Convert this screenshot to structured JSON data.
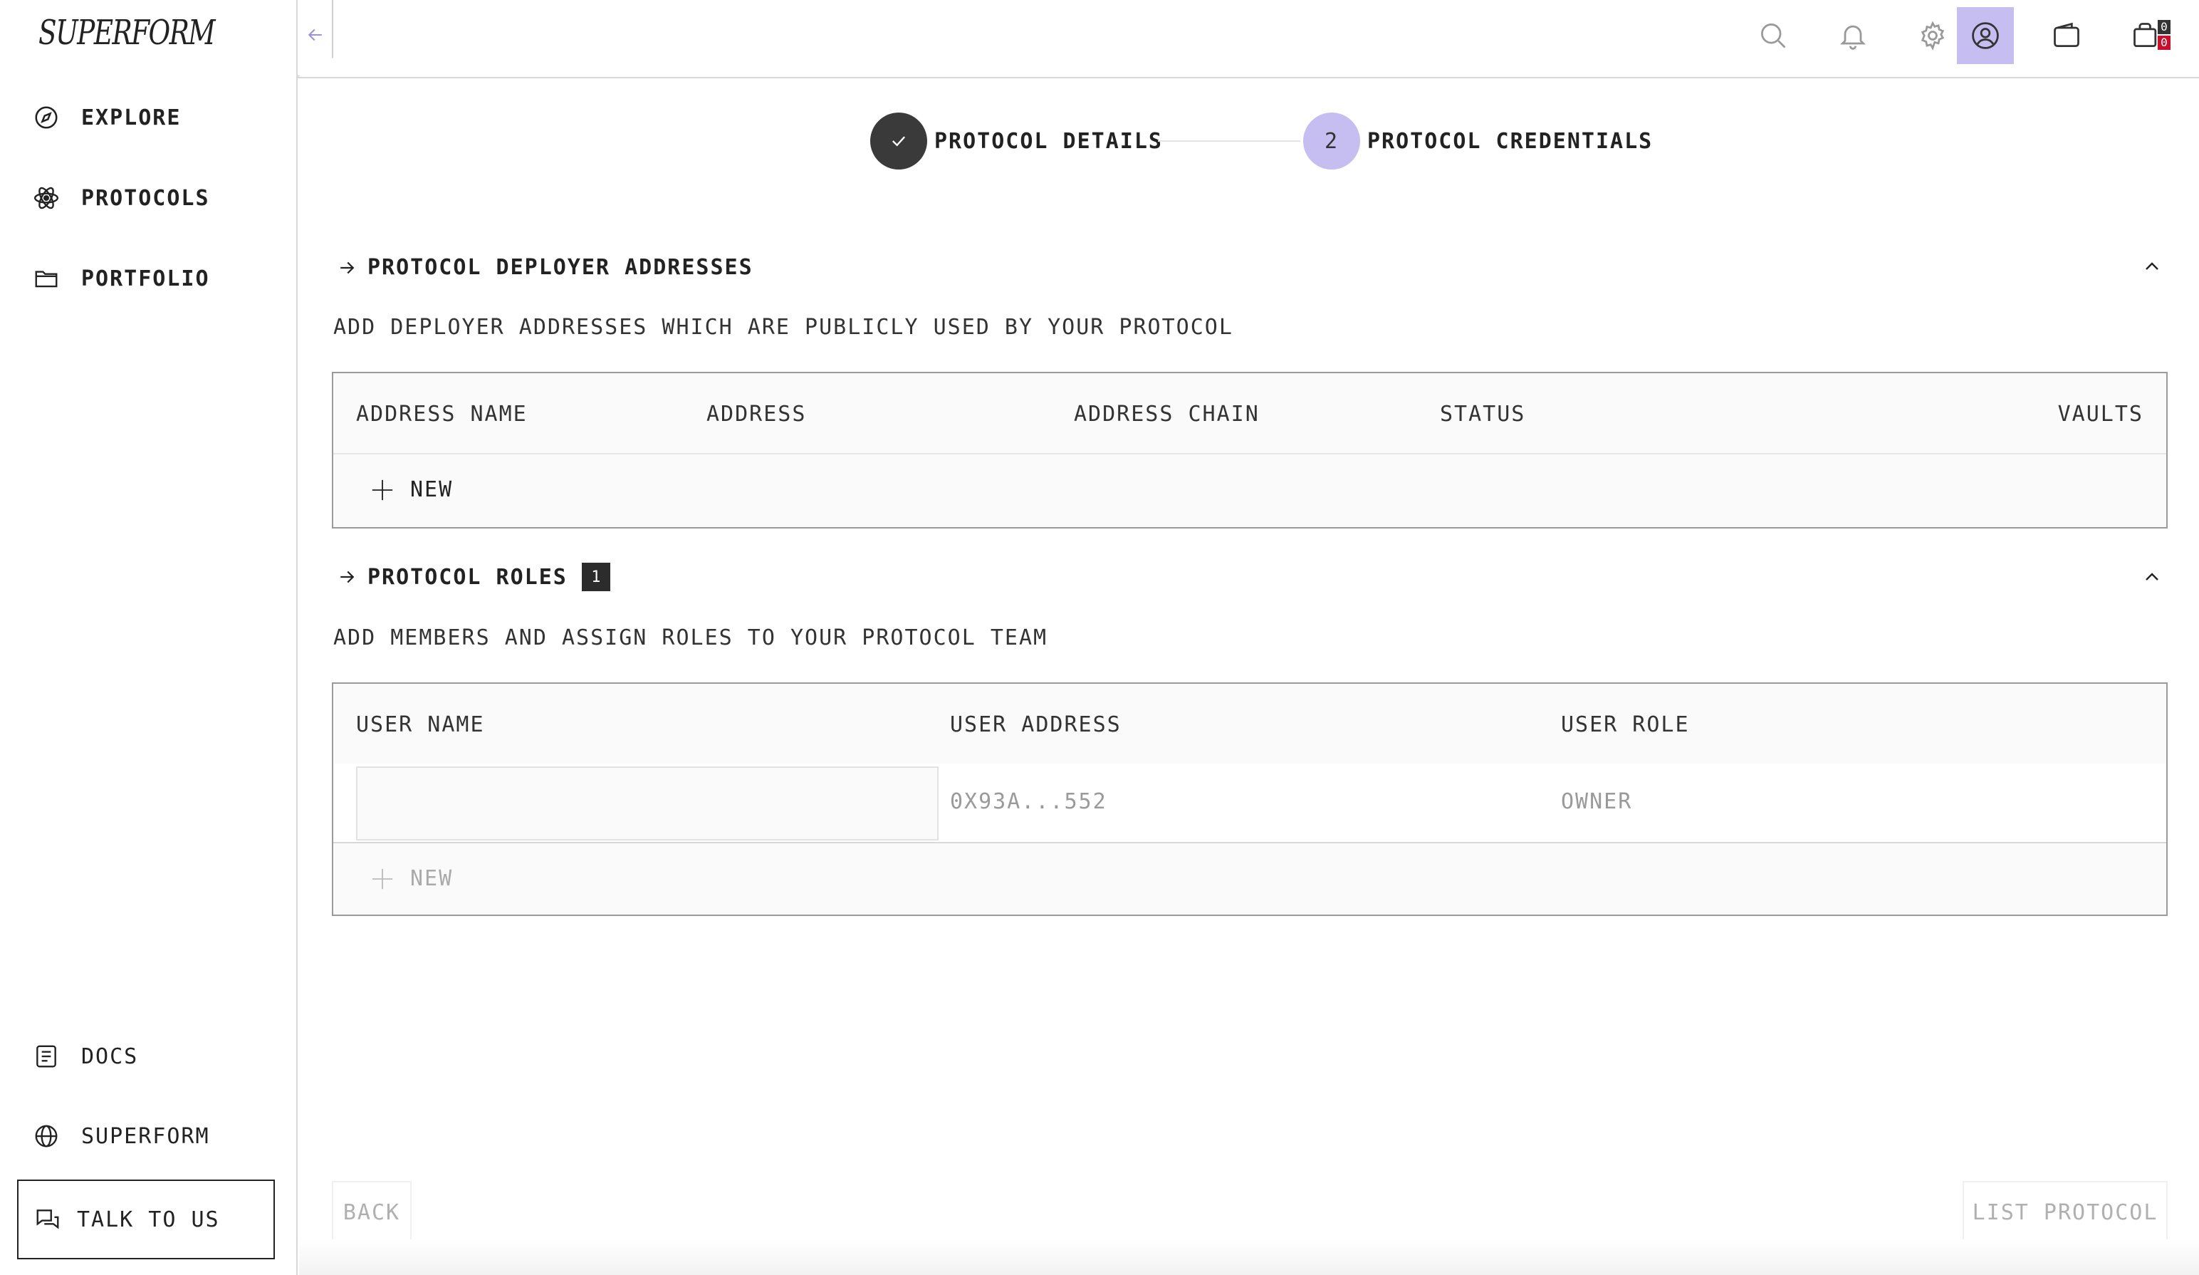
{
  "brand": {
    "logo_text": "SUPERFORM"
  },
  "sidebar": {
    "items": [
      {
        "label": "EXPLORE",
        "icon": "compass-icon"
      },
      {
        "label": "PROTOCOLS",
        "icon": "atom-icon"
      },
      {
        "label": "PORTFOLIO",
        "icon": "folder-icon"
      }
    ],
    "bottom_items": [
      {
        "label": "DOCS",
        "icon": "document-icon"
      },
      {
        "label": "SUPERFORM",
        "icon": "globe-icon"
      }
    ],
    "talk_label": "TALK TO US"
  },
  "topbar": {
    "icons": [
      "search-icon",
      "bell-icon",
      "gear-icon",
      "user-icon",
      "wallet-icon",
      "cart-icon"
    ],
    "cart_counts": [
      "0",
      "0"
    ],
    "accent": "#c6bdf0"
  },
  "stepper": {
    "steps": [
      {
        "number": "",
        "label": "PROTOCOL DETAILS",
        "state": "done"
      },
      {
        "number": "2",
        "label": "PROTOCOL CREDENTIALS",
        "state": "current"
      }
    ]
  },
  "deployer": {
    "title": "PROTOCOL DEPLOYER ADDRESSES",
    "description": "ADD DEPLOYER ADDRESSES WHICH ARE PUBLICLY USED BY YOUR PROTOCOL",
    "columns": [
      "ADDRESS NAME",
      "ADDRESS",
      "ADDRESS CHAIN",
      "STATUS",
      "VAULTS"
    ],
    "new_label": "NEW"
  },
  "roles": {
    "title": "PROTOCOL ROLES",
    "count": "1",
    "description": "ADD MEMBERS AND ASSIGN ROLES TO YOUR PROTOCOL TEAM",
    "columns": [
      "USER NAME",
      "USER ADDRESS",
      "USER ROLE"
    ],
    "rows": [
      {
        "user_name": "",
        "user_address": "0X93A...552",
        "user_role": "OWNER"
      }
    ],
    "new_label": "NEW"
  },
  "footer": {
    "back_label": "BACK",
    "list_label": "LIST PROTOCOL"
  }
}
